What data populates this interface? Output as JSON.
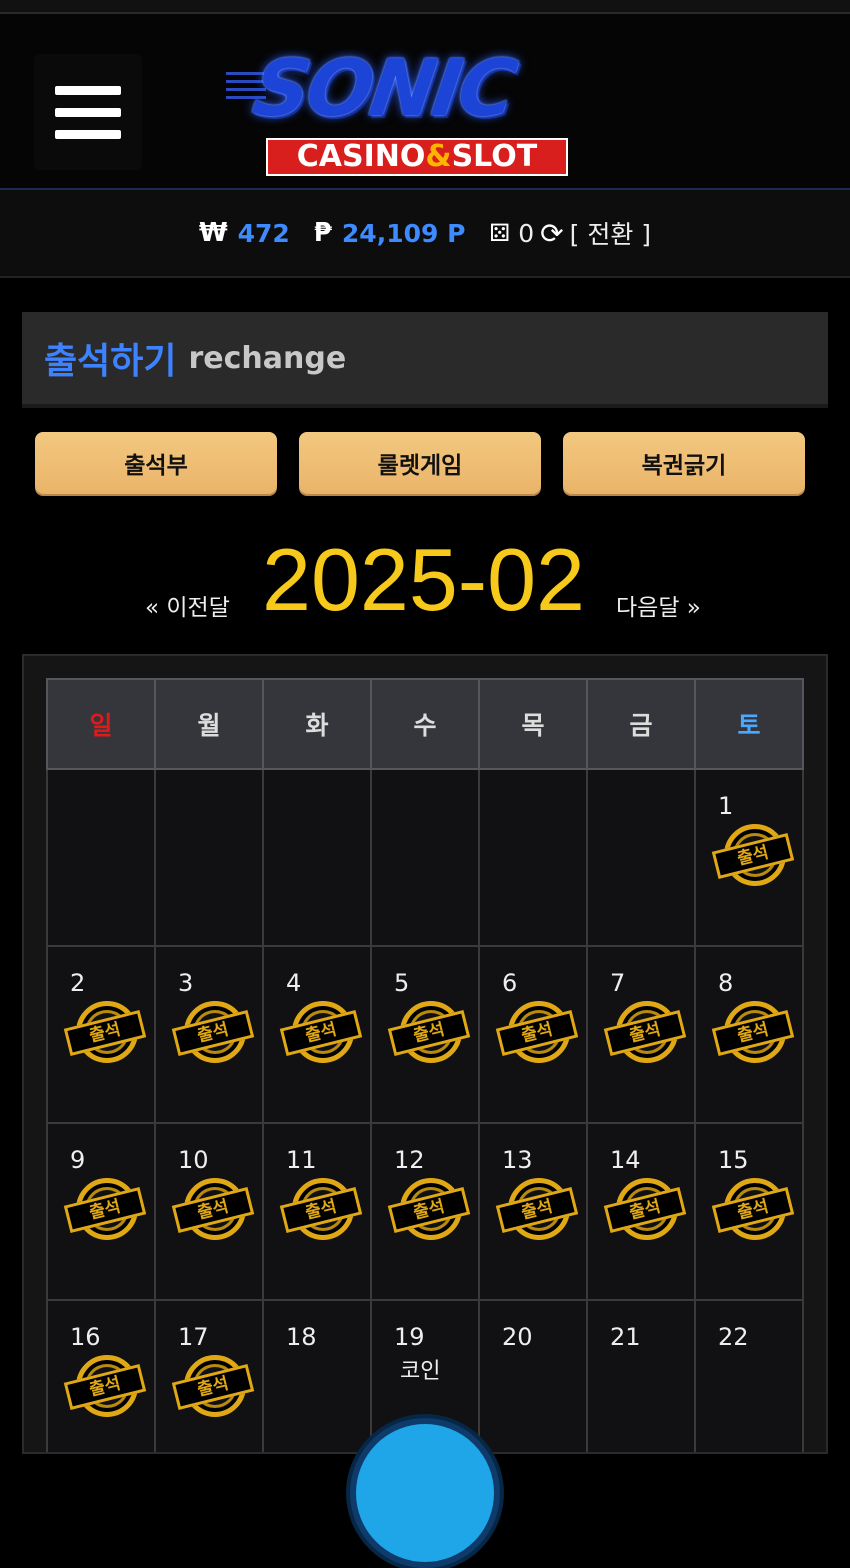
{
  "header": {
    "logo_main": "SONIC",
    "logo_sub_1": "CASINO",
    "logo_amp": "&",
    "logo_sub_2": "SLOT"
  },
  "balance": {
    "won_symbol": "₩",
    "won_value": "472",
    "point_symbol": "₱",
    "point_value": "24,109 P",
    "dice_value": "0",
    "convert_label": "[ 전환 ]"
  },
  "panel": {
    "title_ko": "출석하기",
    "title_en": "rechange"
  },
  "tabs": [
    "출석부",
    "룰렛게임",
    "복권긁기"
  ],
  "month_nav": {
    "prev": "« 이전달",
    "current": "2025-02",
    "next": "다음달 »"
  },
  "calendar": {
    "weekdays": [
      "일",
      "월",
      "화",
      "수",
      "목",
      "금",
      "토"
    ],
    "stamp_label": "출석",
    "weeks": [
      [
        null,
        null,
        null,
        null,
        null,
        null,
        {
          "day": "1",
          "stamp": true
        }
      ],
      [
        {
          "day": "2",
          "stamp": true
        },
        {
          "day": "3",
          "stamp": true
        },
        {
          "day": "4",
          "stamp": true
        },
        {
          "day": "5",
          "stamp": true
        },
        {
          "day": "6",
          "stamp": true
        },
        {
          "day": "7",
          "stamp": true
        },
        {
          "day": "8",
          "stamp": true
        }
      ],
      [
        {
          "day": "9",
          "stamp": true
        },
        {
          "day": "10",
          "stamp": true
        },
        {
          "day": "11",
          "stamp": true
        },
        {
          "day": "12",
          "stamp": true
        },
        {
          "day": "13",
          "stamp": true
        },
        {
          "day": "14",
          "stamp": true
        },
        {
          "day": "15",
          "stamp": true
        }
      ],
      [
        {
          "day": "16",
          "stamp": true
        },
        {
          "day": "17",
          "stamp": true
        },
        {
          "day": "18",
          "stamp": false
        },
        {
          "day": "19",
          "stamp": false,
          "note": "코인"
        },
        {
          "day": "20",
          "stamp": false
        },
        {
          "day": "21",
          "stamp": false
        },
        {
          "day": "22",
          "stamp": false
        }
      ]
    ]
  },
  "colors": {
    "accent_blue": "#3f82ff",
    "month_yellow": "#f7c91b",
    "tab_gold": "#f3c87f",
    "sunday_red": "#e0191b",
    "saturday_blue": "#4aa8ff",
    "stamp_gold": "#e0a814"
  }
}
